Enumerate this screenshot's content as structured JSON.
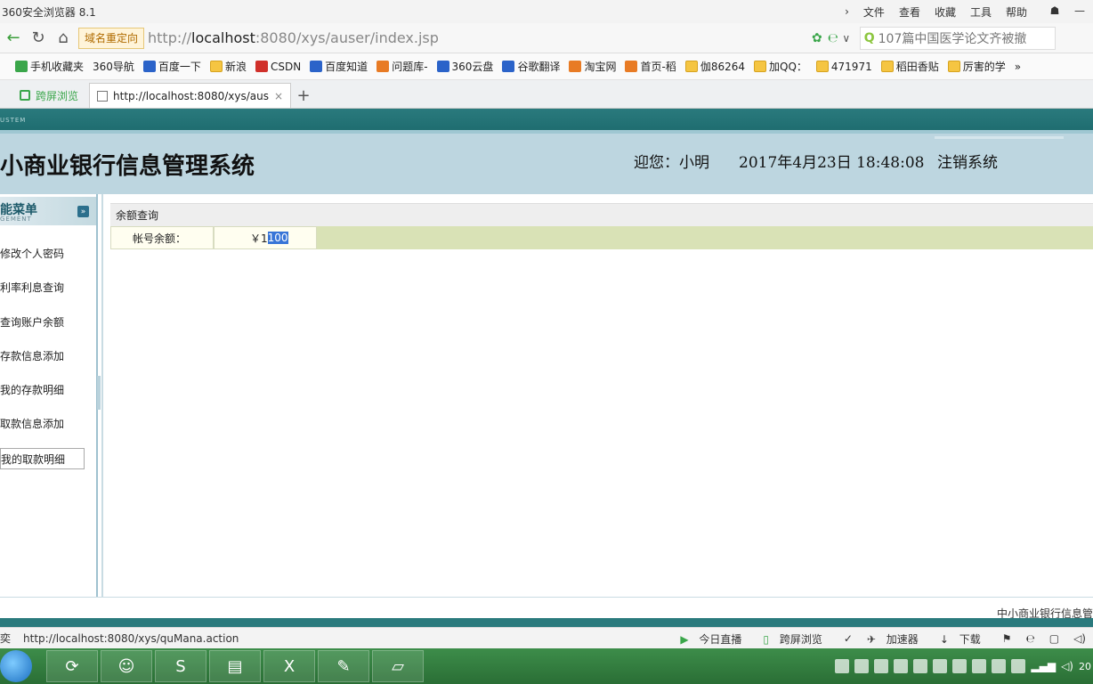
{
  "browser": {
    "title": "360安全浏览器 8.1",
    "menu": [
      "文件",
      "查看",
      "收藏",
      "工具",
      "帮助"
    ],
    "redirect_label": "域名重定向",
    "url_prefix": "http://",
    "url_host": "localhost",
    "url_rest": ":8080/xys/auser/index.jsp",
    "search_text": "107篇中国医学论文齐被撤",
    "bookmarks": [
      "手机收藏夹",
      "360导航",
      "百度一下",
      "新浪",
      "CSDN",
      "百度知道",
      "问题库-",
      "360云盘",
      "谷歌翻译",
      "淘宝网",
      "首页-稻",
      "伽86264",
      "加QQ：",
      "471971",
      "稻田香贴",
      "厉害的学"
    ],
    "tabs": {
      "split_label": "跨屏浏览",
      "active_label": "http://localhost:8080/xys/aus"
    }
  },
  "app": {
    "title": "小商业银行信息管理系统",
    "welcome": "迎您：小明",
    "datetime": "2017年4月23日  18:48:08",
    "logout": "注销系统",
    "strip_tag": "USTEM",
    "sidebar": {
      "title": "能菜单",
      "subtitle": "GEMENT",
      "items": [
        "修改个人密码",
        "利率利息查询",
        "查询账户余额",
        "存款信息添加",
        "我的存款明细",
        "取款信息添加",
        "我的取款明细"
      ]
    },
    "panel": {
      "title": "余额查询",
      "label": "帐号余额：",
      "currency": "￥1",
      "value_selected": "100"
    },
    "footer": "中小商业银行信息管"
  },
  "status": {
    "left": "奕",
    "url": "http://localhost:8080/xys/quMana.action",
    "right": [
      "今日直播",
      "跨屏浏览",
      "加速器",
      "下载"
    ]
  },
  "taskbar": {
    "clock": "20"
  }
}
